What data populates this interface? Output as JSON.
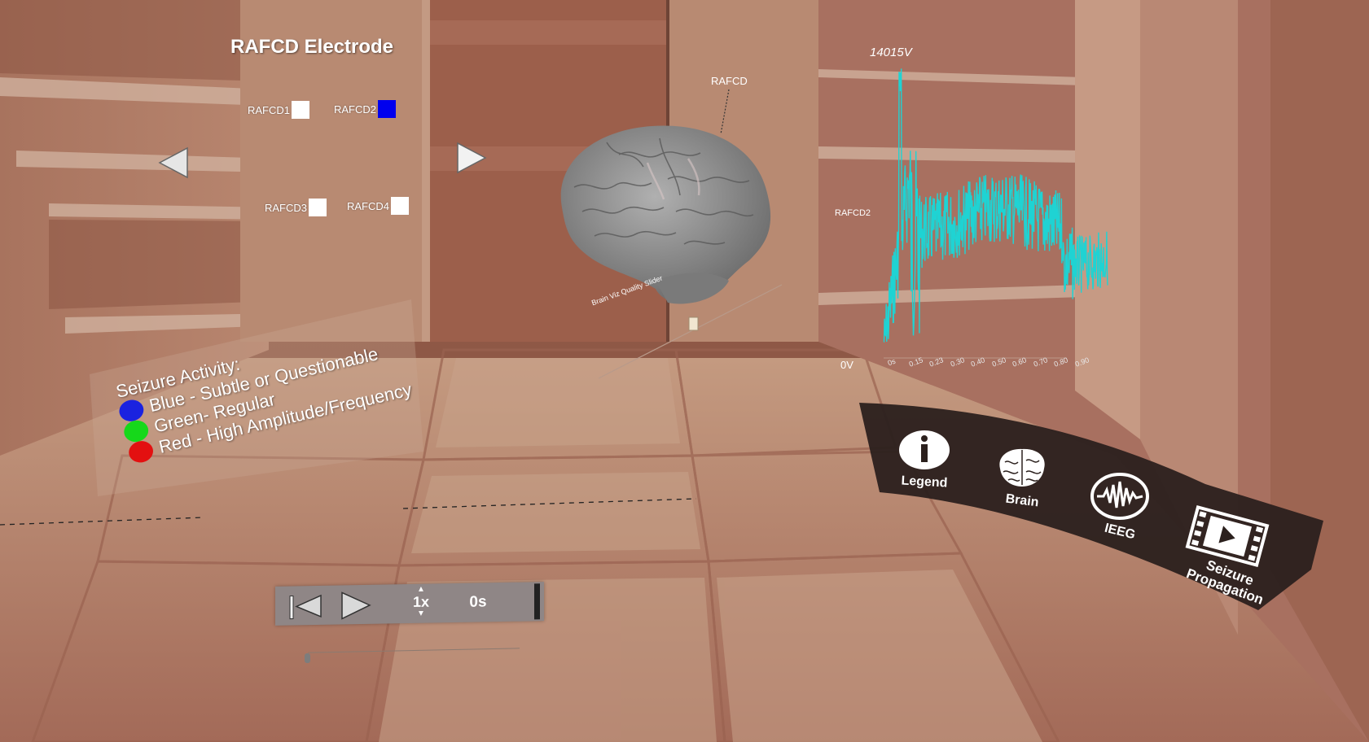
{
  "electrode_panel": {
    "title": "RAFCD Electrode",
    "electrodes": [
      {
        "label": "RAFCD1",
        "color": "#ffffff"
      },
      {
        "label": "RAFCD2",
        "color": "#0000ee"
      },
      {
        "label": "RAFCD3",
        "color": "#ffffff"
      },
      {
        "label": "RAFCD4",
        "color": "#ffffff"
      }
    ]
  },
  "legend": {
    "heading": "Seizure Activity:",
    "items": [
      {
        "label": "Blue - Subtle or Questionable",
        "color": "#1a22e0"
      },
      {
        "label": "Green- Regular",
        "color": "#16d81a"
      },
      {
        "label": "Red - High Amplitude/Frequency",
        "color": "#e31010"
      }
    ]
  },
  "brain": {
    "electrode_label": "RAFCD",
    "quality_slider_label": "Brain Viz Quality Slider"
  },
  "ieeg_plot": {
    "max_label": "14015V",
    "min_label": "0V",
    "channel_label": "RAFCD2",
    "time_ticks": [
      "0s",
      "0.15",
      "0.23",
      "0.30",
      "0.40",
      "0.50",
      "0.60",
      "0.70",
      "0.80",
      "0.90"
    ],
    "color": "#1fd3d3"
  },
  "playback": {
    "speed": "1x",
    "time": "0s"
  },
  "menu": {
    "items": [
      {
        "label": "Legend",
        "icon": "info-icon"
      },
      {
        "label": "Brain",
        "icon": "brain-icon"
      },
      {
        "label": "IEEG",
        "icon": "waveform-icon"
      },
      {
        "label": "Seizure\nPropagation",
        "icon": "video-icon"
      }
    ]
  }
}
